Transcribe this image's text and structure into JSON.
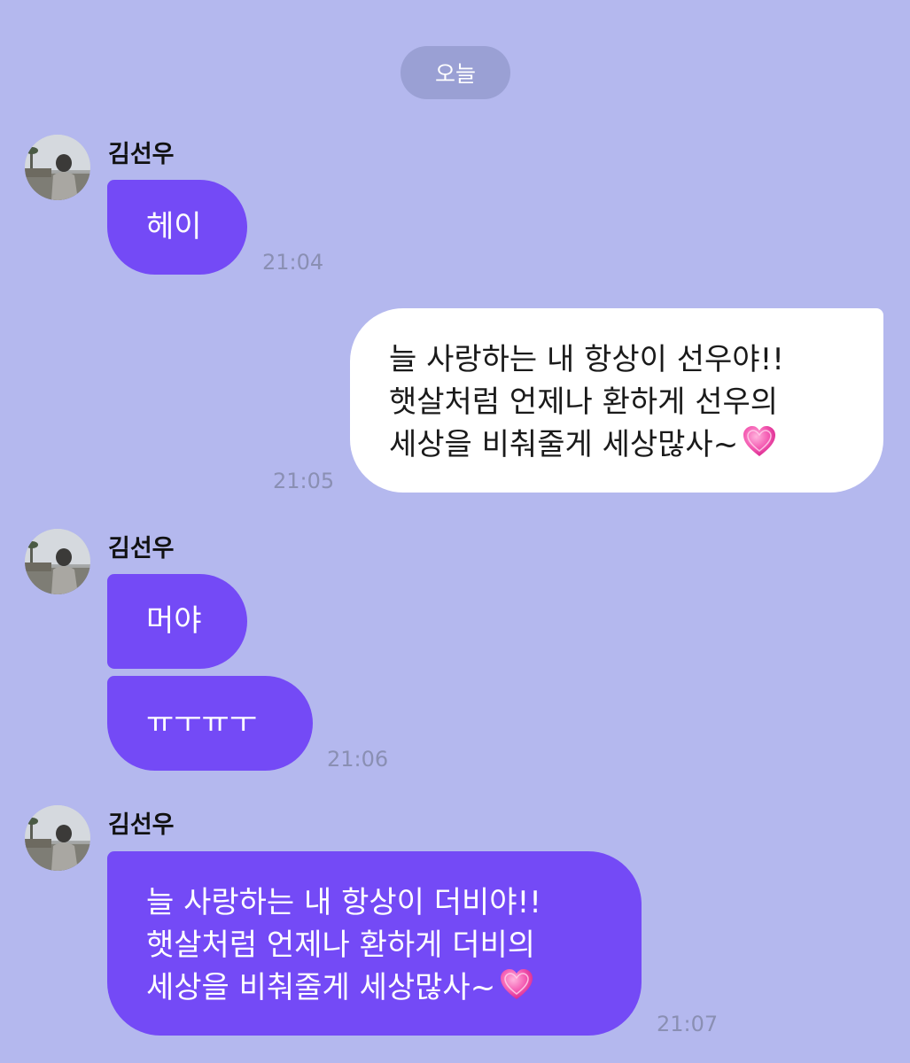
{
  "chat": {
    "date_divider": "오늘",
    "sender_name": "김선우",
    "messages": [
      {
        "direction": "in",
        "text": "헤이",
        "time": "21:04"
      },
      {
        "direction": "out",
        "text": "늘 사랑하는 내 항상이 선우야!!\n햇살처럼 언제나 환하게 선우의\n세상을 비춰줄게 세상많사~",
        "emoji": "heart",
        "time": "21:05"
      },
      {
        "direction": "in",
        "text": "머야"
      },
      {
        "direction": "in",
        "text": "ㅠㅜㅠㅜ",
        "time": "21:06"
      },
      {
        "direction": "in",
        "text": "늘 사랑하는 내 항상이 더비야!!\n햇살처럼 언제나 환하게 더비의\n세상을 비춰줄게 세상많사~",
        "emoji": "heart",
        "time": "21:07"
      }
    ]
  },
  "colors": {
    "background": "#b4b8ee",
    "incoming_bubble": "#744af6",
    "outgoing_bubble": "#ffffff",
    "date_pill": "#9aa0d4",
    "timestamp": "#8a8fb3"
  }
}
